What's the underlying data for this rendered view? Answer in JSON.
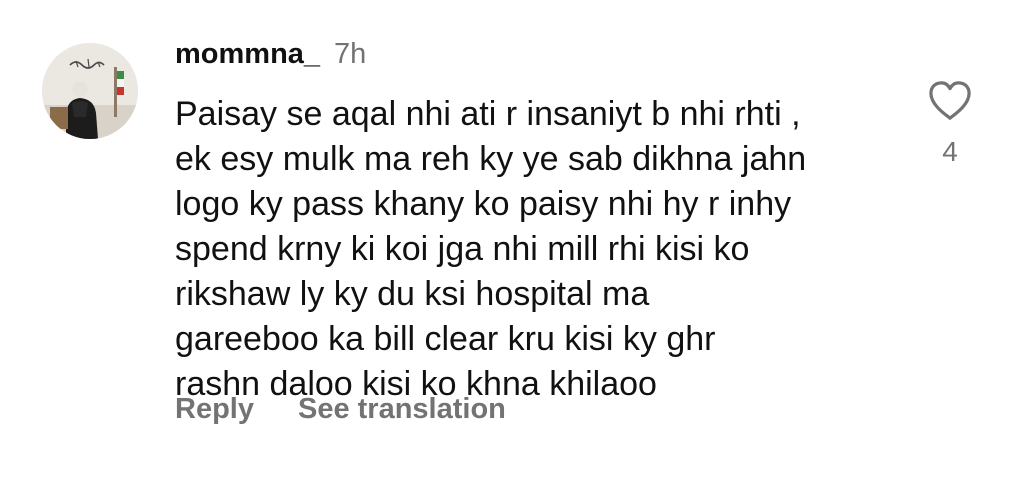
{
  "comment": {
    "username": "mommna_",
    "timestamp": "7h",
    "lines": [
      "Paisay se aqal nhi ati r insaniyt b nhi rhti ,",
      "ek esy mulk ma reh ky ye sab dikhna jahn",
      "logo ky pass khany ko paisy nhi hy r inhy",
      "spend krny ki koi jga nhi mill rhi kisi ko",
      "rikshaw ly ky du ksi hospital ma",
      "gareeboo ka bill clear kru kisi ky ghr",
      "rashn daloo kisi ko khna khilaoo"
    ],
    "actions": {
      "reply_label": "Reply",
      "translate_label": "See translation"
    },
    "likes": {
      "icon": "heart-outline-icon",
      "count": "4"
    },
    "avatar_icon": "profile-photo"
  },
  "colors": {
    "text": "#111111",
    "secondary": "#737373",
    "background": "#ffffff"
  }
}
